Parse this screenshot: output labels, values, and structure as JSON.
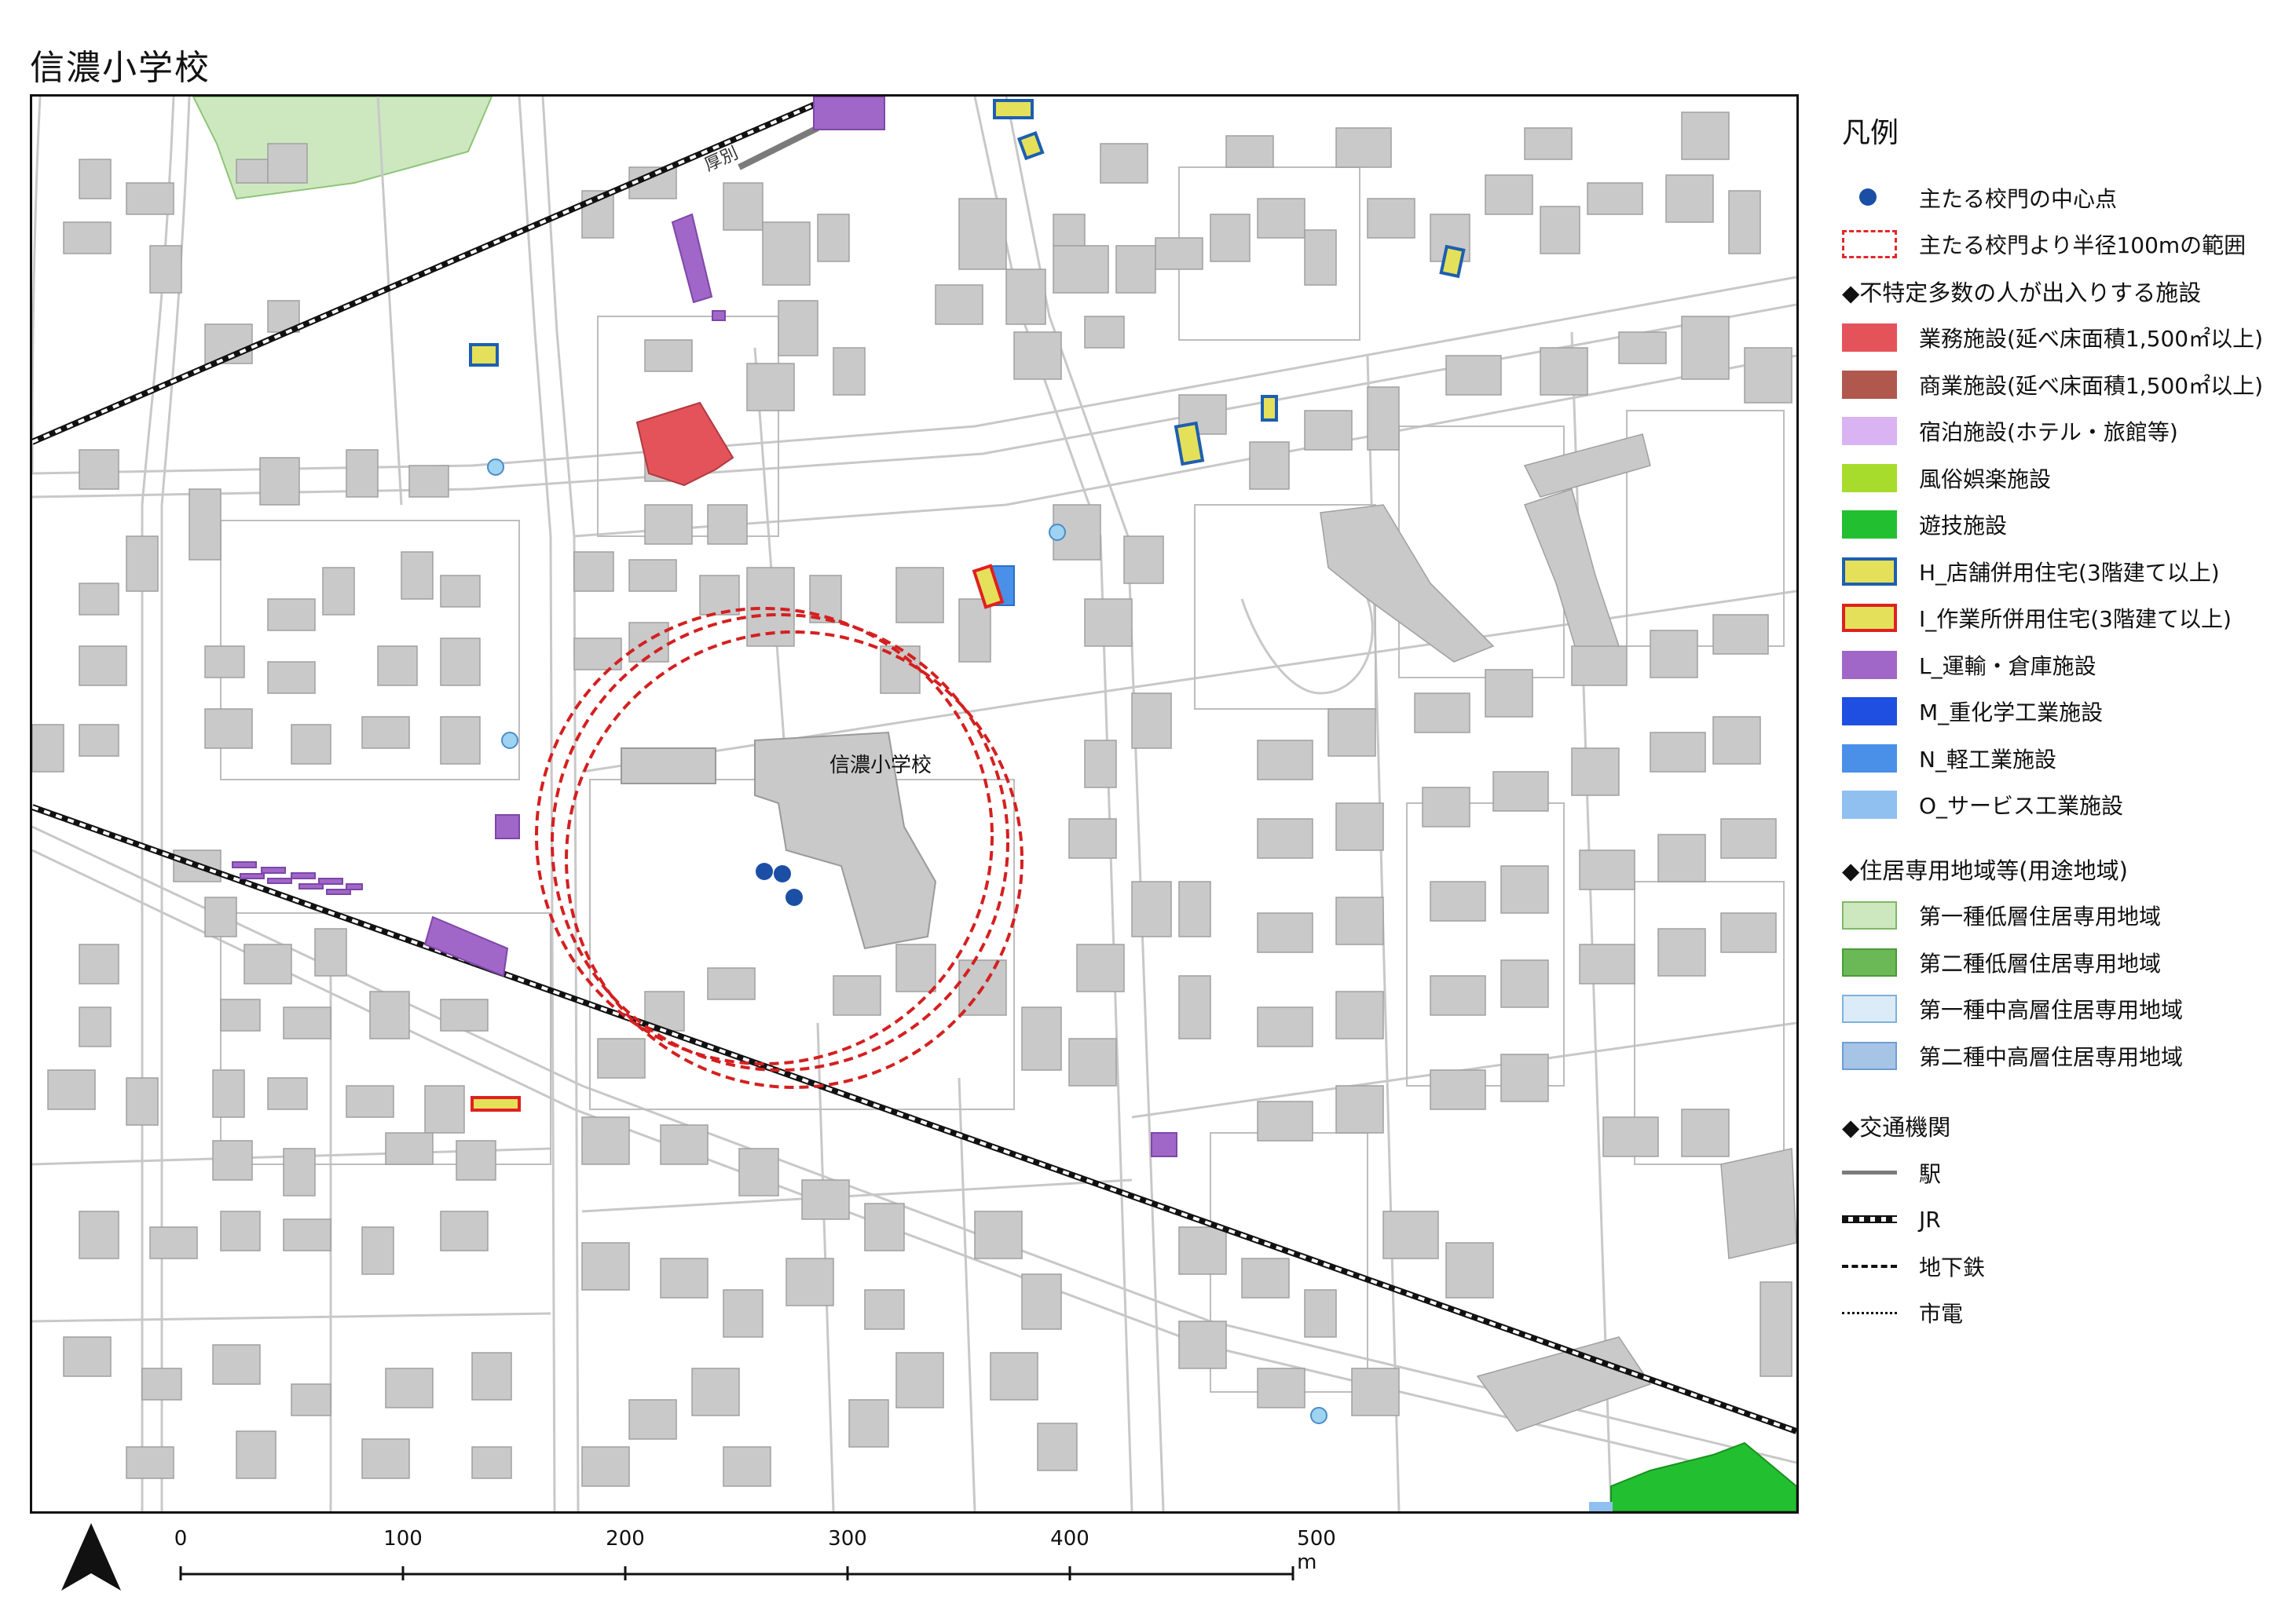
{
  "title": "信濃小学校",
  "map": {
    "school_label": "信濃小学校",
    "station_label": "厚別",
    "colors": {
      "background": "#ffffff",
      "road_outline": "#c8c8c8",
      "block_line": "#bdbdbd",
      "building": "#c9c9c9",
      "gate_point": "#1b4fa6",
      "buffer_circle": "#d42020",
      "jr_line": "#111111",
      "station": "#7b7b7b",
      "zone1_low": "#cde8bf",
      "business": "#e5535a",
      "transport": "#a066c8",
      "heavy_industry": "#1f4fe0",
      "light_industry": "#4a90e8",
      "service_industry": "#8fc0f0",
      "shop_house": "#e5e05a",
      "amusement": "#22c030"
    }
  },
  "legend": {
    "title": "凡例",
    "items": [
      {
        "label": "主たる校門の中心点",
        "type": "dot",
        "color": "#1b4fa6"
      },
      {
        "label": "主たる校門より半径100mの範囲",
        "type": "dash",
        "color": "#e0282a"
      },
      {
        "label": "◆不特定多数の人が出入りする施設",
        "type": "heading"
      },
      {
        "label": "業務施設(延べ床面積1,500㎡以上)",
        "type": "fill",
        "color": "#e5535a"
      },
      {
        "label": "商業施設(延べ床面積1,500㎡以上)",
        "type": "fill",
        "color": "#b0584e"
      },
      {
        "label": "宿泊施設(ホテル・旅館等)",
        "type": "fill",
        "color": "#d9b3f2"
      },
      {
        "label": "風俗娯楽施設",
        "type": "fill",
        "color": "#a8dc2c"
      },
      {
        "label": "遊技施設",
        "type": "fill",
        "color": "#22c030"
      },
      {
        "label": "H_店舗併用住宅(3階建て以上)",
        "type": "outline-blue",
        "color": "#e5e05a"
      },
      {
        "label": "I_作業所併用住宅(3階建て以上)",
        "type": "outline-red",
        "color": "#e5e05a"
      },
      {
        "label": "L_運輸・倉庫施設",
        "type": "fill",
        "color": "#a066c8"
      },
      {
        "label": "M_重化学工業施設",
        "type": "fill",
        "color": "#1f4fe0"
      },
      {
        "label": "N_軽工業施設",
        "type": "fill",
        "color": "#4a90e8"
      },
      {
        "label": "O_サービス工業施設",
        "type": "fill",
        "color": "#8fc0f0"
      },
      {
        "label": "◆住居専用地域等(用途地域)",
        "type": "heading",
        "gap": true
      },
      {
        "label": "第一種低層住居専用地域",
        "type": "fill-border",
        "color": "#cde8bf",
        "border": "#7fb866"
      },
      {
        "label": "第二種低層住居専用地域",
        "type": "fill-border",
        "color": "#6ab856",
        "border": "#4a9a3a"
      },
      {
        "label": "第一種中高層住居専用地域",
        "type": "fill-border",
        "color": "#dcebf8",
        "border": "#7fb0dc"
      },
      {
        "label": "第二種中高層住居専用地域",
        "type": "fill-border",
        "color": "#a5c4e6",
        "border": "#6f9ed0"
      },
      {
        "label": "◆交通機関",
        "type": "heading",
        "gap2": true
      },
      {
        "label": "駅",
        "type": "line"
      },
      {
        "label": "JR",
        "type": "jr"
      },
      {
        "label": "地下鉄",
        "type": "subway"
      },
      {
        "label": "市電",
        "type": "tram"
      }
    ]
  },
  "scale": {
    "ticks": [
      "0",
      "100",
      "200",
      "300",
      "400",
      "500 m"
    ]
  }
}
